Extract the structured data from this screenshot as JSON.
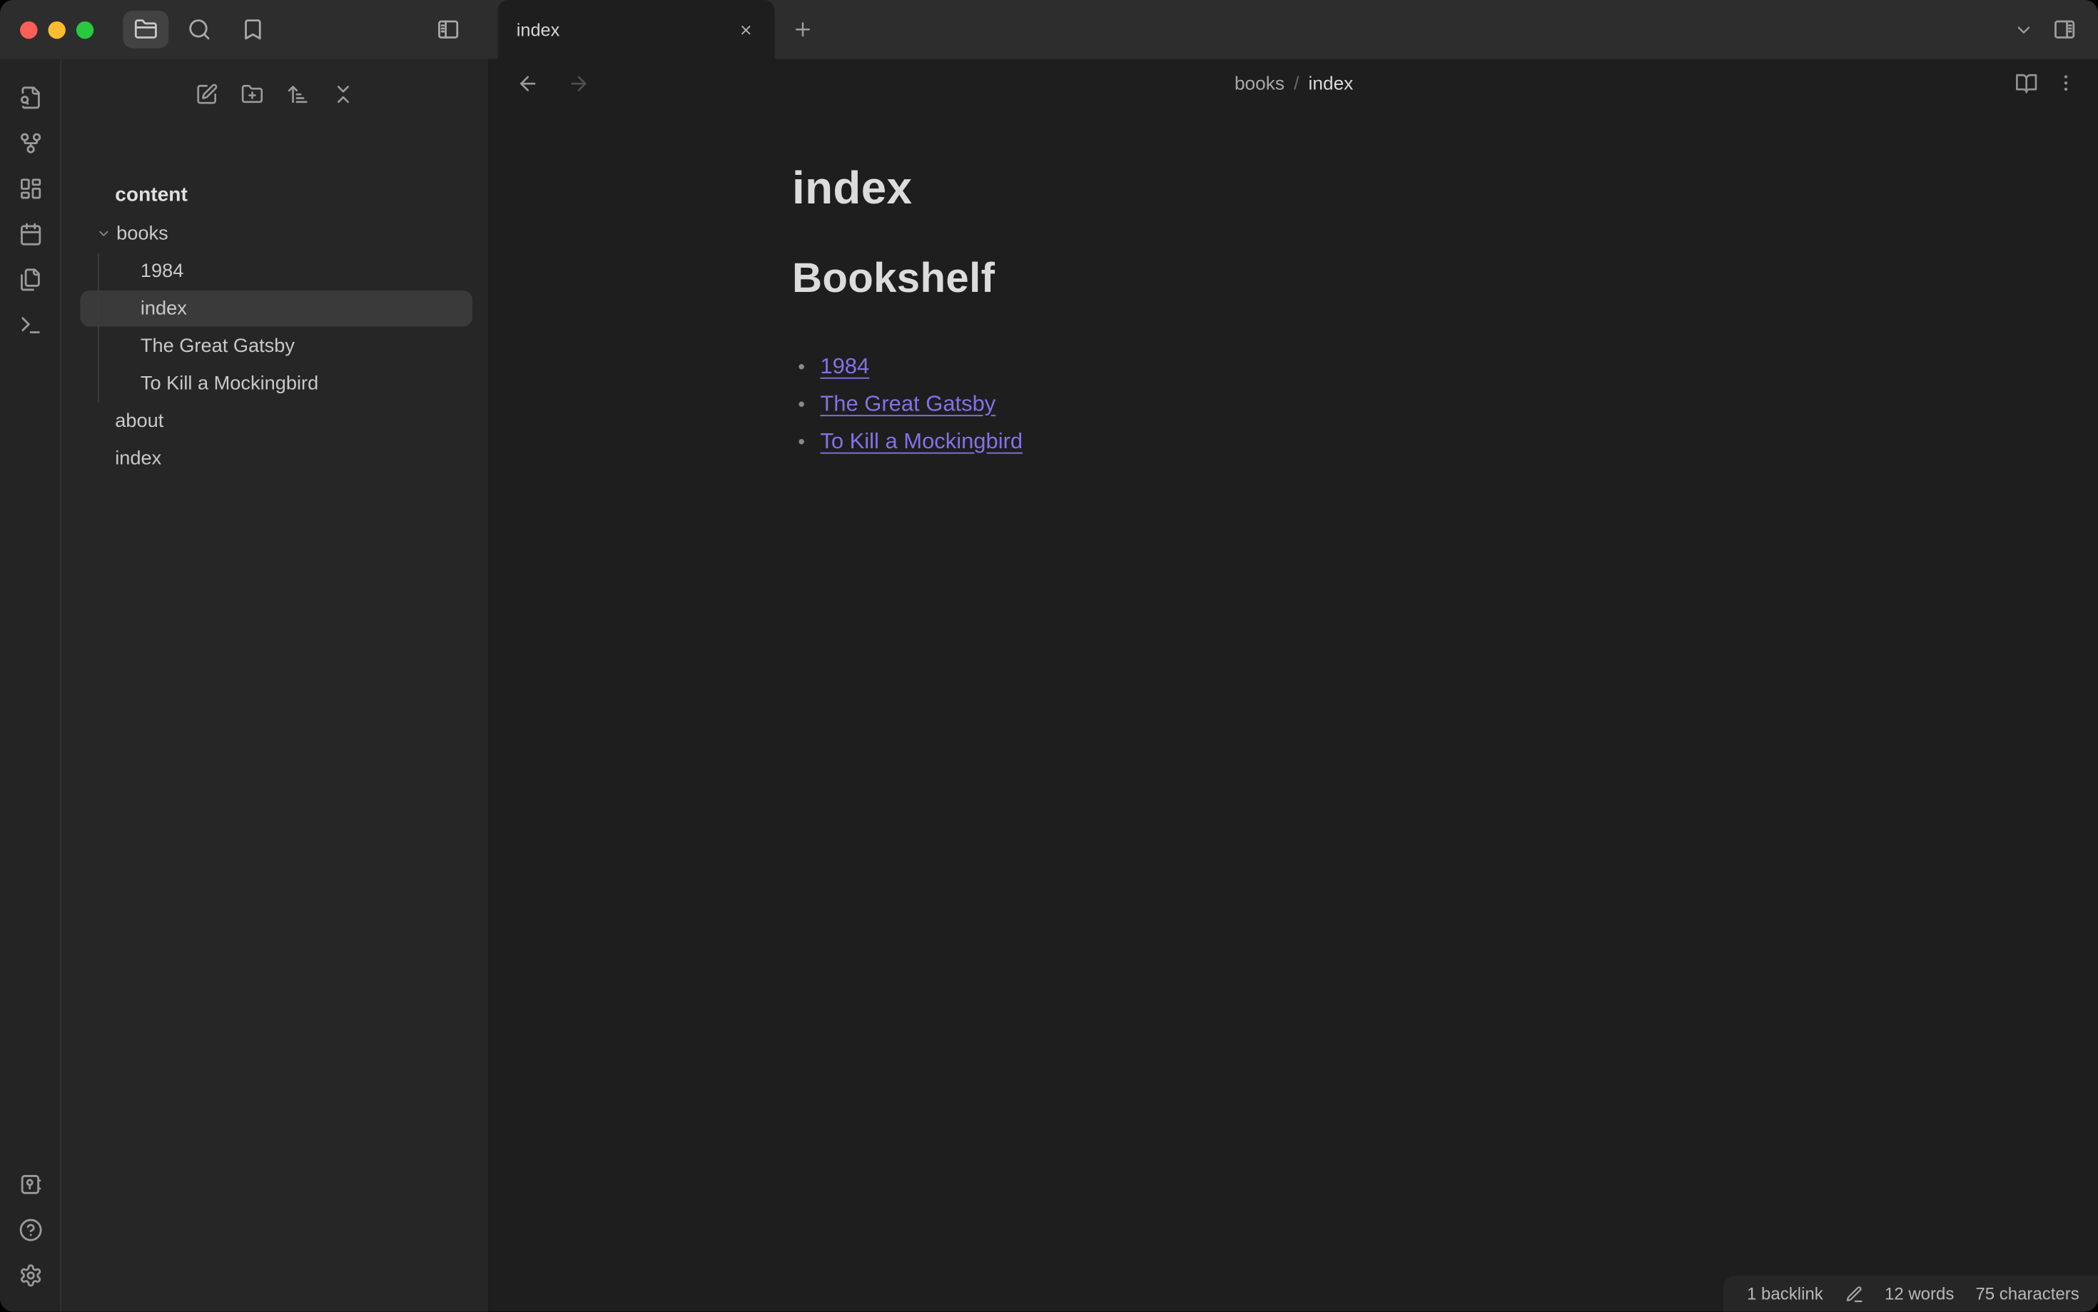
{
  "colors": {
    "bg_editor": "#1e1e1e",
    "bg_sidebar": "#262626",
    "bg_titlebar": "#2d2d2d",
    "selected_row": "#3a3a3a",
    "link_accent": "#8571e6",
    "traffic_close": "#ff5f57",
    "traffic_minimize": "#febc2e",
    "traffic_zoom": "#28c840"
  },
  "titlebar": {
    "icons": [
      "folder",
      "search",
      "bookmark",
      "panel-left-toggle"
    ],
    "tab": {
      "label": "index",
      "close_icon": "x",
      "new_tab_icon": "plus"
    },
    "right_icons": [
      "chevron-down",
      "panel-right-toggle"
    ]
  },
  "ribbon": {
    "top_icons": [
      "file-search",
      "graph",
      "canvas",
      "calendar",
      "files",
      "terminal"
    ],
    "bottom_icons": [
      "vault",
      "help",
      "settings"
    ]
  },
  "sidebar": {
    "toolbar_icons": [
      "new-note",
      "new-folder",
      "sort",
      "collapse-all"
    ],
    "tree": {
      "vault_name": "content",
      "items": [
        {
          "label": "books",
          "type": "folder",
          "depth": 0,
          "expanded": true,
          "selected": false
        },
        {
          "label": "1984",
          "type": "file",
          "depth": 1,
          "selected": false
        },
        {
          "label": "index",
          "type": "file",
          "depth": 1,
          "selected": true
        },
        {
          "label": "The Great Gatsby",
          "type": "file",
          "depth": 1,
          "selected": false
        },
        {
          "label": "To Kill a Mockingbird",
          "type": "file",
          "depth": 1,
          "selected": false
        },
        {
          "label": "about",
          "type": "file",
          "depth": 0,
          "selected": false
        },
        {
          "label": "index",
          "type": "file",
          "depth": 0,
          "selected": false
        }
      ]
    }
  },
  "main": {
    "breadcrumb": {
      "segments": [
        "books",
        "index"
      ],
      "separator": "/"
    },
    "header_icons": [
      "arrow-left",
      "arrow-right",
      "book-open",
      "more-options"
    ],
    "note": {
      "title": "index",
      "heading": "Bookshelf",
      "links": [
        "1984",
        "The Great Gatsby",
        "To Kill a Mockingbird"
      ]
    }
  },
  "statusbar": {
    "backlinks": "1 backlink",
    "mode_icon": "pencil",
    "words": "12 words",
    "characters": "75 characters"
  }
}
